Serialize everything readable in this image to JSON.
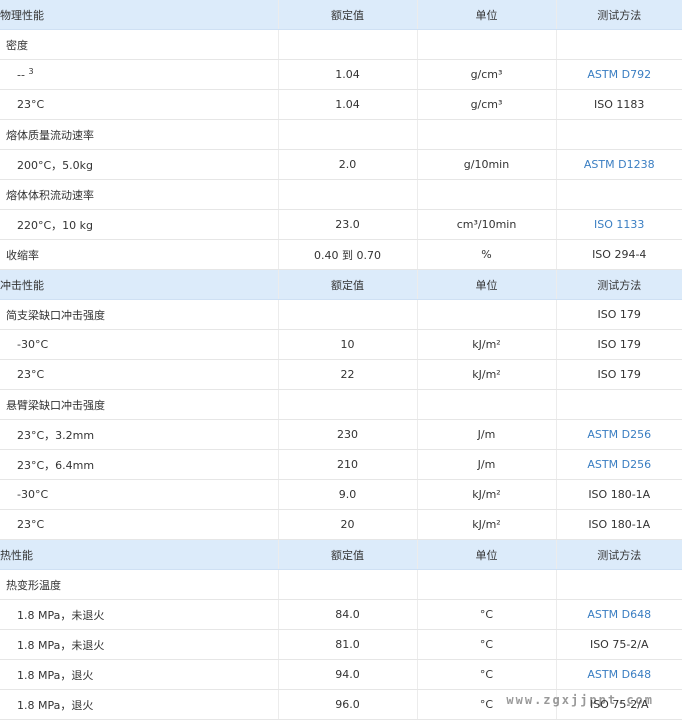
{
  "sections": [
    {
      "header": [
        "物理性能",
        "额定值",
        "单位",
        "测试方法"
      ],
      "rows": [
        {
          "kind": "group",
          "name": "密度",
          "value": "",
          "unit": "",
          "method": "",
          "link": false
        },
        {
          "kind": "sub",
          "name": "-- ",
          "sup": "3",
          "value": "1.04",
          "unit": "g/cm³",
          "method": "ASTM D792",
          "link": true
        },
        {
          "kind": "sub",
          "name": "23°C",
          "value": "1.04",
          "unit": "g/cm³",
          "method": "ISO 1183",
          "link": false
        },
        {
          "kind": "group",
          "name": "熔体质量流动速率",
          "value": "",
          "unit": "",
          "method": "",
          "link": false
        },
        {
          "kind": "sub",
          "name": "200°C，5.0kg",
          "value": "2.0",
          "unit": "g/10min",
          "method": "ASTM D1238",
          "link": true
        },
        {
          "kind": "group",
          "name": "熔体体积流动速率",
          "value": "",
          "unit": "",
          "method": "",
          "link": false
        },
        {
          "kind": "sub",
          "name": "220°C，10 kg",
          "value": "23.0",
          "unit": "cm³/10min",
          "method": "ISO 1133",
          "link": true
        },
        {
          "kind": "group",
          "name": "收缩率",
          "value": "0.40 到 0.70",
          "unit": "%",
          "method": "ISO 294-4",
          "link": false
        }
      ]
    },
    {
      "header": [
        "冲击性能",
        "额定值",
        "单位",
        "测试方法"
      ],
      "rows": [
        {
          "kind": "group",
          "name": "简支梁缺口冲击强度",
          "value": "",
          "unit": "",
          "method": "ISO 179",
          "link": false
        },
        {
          "kind": "sub",
          "name": "-30°C",
          "value": "10",
          "unit": "kJ/m²",
          "method": "ISO 179",
          "link": false
        },
        {
          "kind": "sub",
          "name": "23°C",
          "value": "22",
          "unit": "kJ/m²",
          "method": "ISO 179",
          "link": false
        },
        {
          "kind": "group",
          "name": "悬臂梁缺口冲击强度",
          "value": "",
          "unit": "",
          "method": "",
          "link": false
        },
        {
          "kind": "sub",
          "name": "23°C，3.2mm",
          "value": "230",
          "unit": "J/m",
          "method": "ASTM D256",
          "link": true
        },
        {
          "kind": "sub",
          "name": "23°C，6.4mm",
          "value": "210",
          "unit": "J/m",
          "method": "ASTM D256",
          "link": true
        },
        {
          "kind": "sub",
          "name": "-30°C",
          "value": "9.0",
          "unit": "kJ/m²",
          "method": "ISO 180-1A",
          "link": false
        },
        {
          "kind": "sub",
          "name": "23°C",
          "value": "20",
          "unit": "kJ/m²",
          "method": "ISO 180-1A",
          "link": false
        }
      ]
    },
    {
      "header": [
        "热性能",
        "额定值",
        "单位",
        "测试方法"
      ],
      "rows": [
        {
          "kind": "group",
          "name": "热变形温度",
          "value": "",
          "unit": "",
          "method": "",
          "link": false
        },
        {
          "kind": "sub",
          "name": "1.8 MPa，未退火",
          "value": "84.0",
          "unit": "°C",
          "method": "ASTM D648",
          "link": true
        },
        {
          "kind": "sub",
          "name": "1.8 MPa，未退火",
          "value": "81.0",
          "unit": "°C",
          "method": "ISO 75-2/A",
          "link": false
        },
        {
          "kind": "sub",
          "name": "1.8 MPa，退火",
          "value": "94.0",
          "unit": "°C",
          "method": "ASTM D648",
          "link": true
        },
        {
          "kind": "sub",
          "name": "1.8 MPa，退火",
          "value": "96.0",
          "unit": "°C",
          "method": "ISO 75-2/A",
          "link": false
        }
      ]
    }
  ],
  "watermark": "www.zgxjjppt.com",
  "colors": {
    "section_bg": "#dcebfa",
    "link": "#3a7ec2",
    "text": "#333333"
  }
}
